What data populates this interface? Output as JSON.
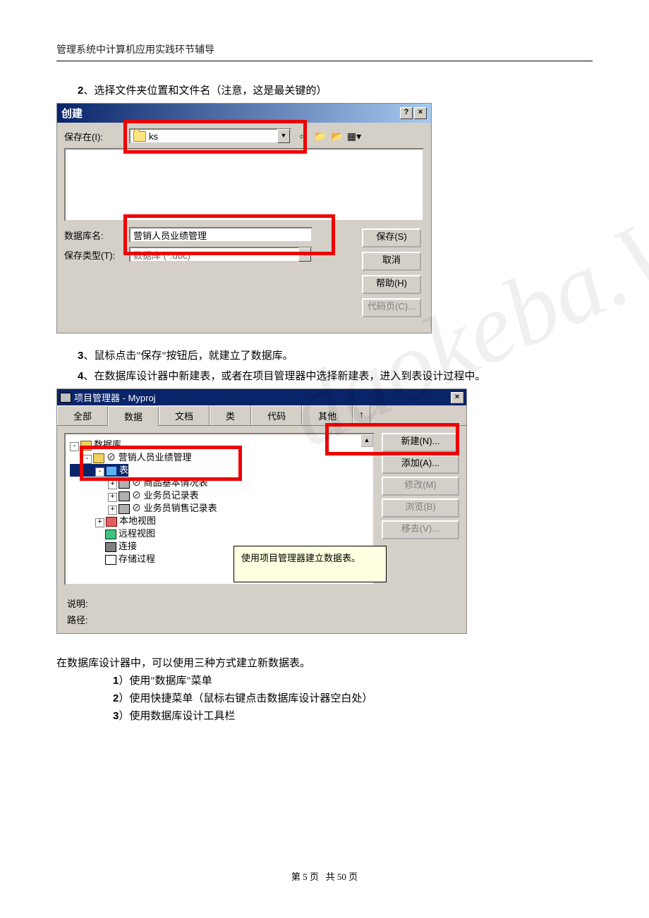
{
  "header": "管理系统中计算机应用实践环节辅导",
  "step2": {
    "num": "2",
    "text": "、选择文件夹位置和文件名（注意，这是最关键的）"
  },
  "createDialog": {
    "title": "创建",
    "saveInLabel": "保存在(I):",
    "saveInValue": "ks",
    "dbNameLabel": "数据库名:",
    "dbNameValue": "营销人员业绩管理",
    "saveTypeLabel": "保存类型(T):",
    "saveTypeValue": "数据库 (*.dbc)",
    "buttons": {
      "save": "保存(S)",
      "cancel": "取消",
      "help": "帮助(H)",
      "codepage": "代码页(C)..."
    }
  },
  "step3": {
    "num": "3",
    "text": "、鼠标点击\"保存\"按钮后，就建立了数据库。"
  },
  "step4": {
    "num": "4",
    "text": "、在数据库设计器中新建表，或者在项目管理器中选择新建表，进入到表设计过程中。"
  },
  "projectManager": {
    "title": "项目管理器 - Myproj",
    "tabs": [
      "全部",
      "数据",
      "文档",
      "类",
      "代码",
      "其他"
    ],
    "tree": {
      "root": "数据库",
      "db": "⊘ 营销人员业绩管理",
      "tables": "表",
      "items": [
        "⊘ 商品基本情况表",
        "⊘ 业务员记录表",
        "⊘ 业务员销售记录表"
      ],
      "localView": "本地视图",
      "remoteView": "远程视图",
      "connection": "连接",
      "storedProc": "存储过程"
    },
    "buttons": {
      "new": "新建(N)...",
      "add": "添加(A)...",
      "modify": "修改(M)",
      "browse": "浏览(B)",
      "remove": "移去(V)..."
    },
    "tooltip": "使用项目管理器建立数据表。",
    "descLabel": "说明:",
    "pathLabel": "路径:"
  },
  "bodyText": "在数据库设计器中，可以使用三种方式建立新数据表。",
  "methods": [
    {
      "num": "1",
      "text": "）使用\"数据库\"菜单"
    },
    {
      "num": "2",
      "text": "）使用快捷菜单（鼠标右键点击数据库设计器空白处）"
    },
    {
      "num": "3",
      "text": "）使用数据库设计工具栏"
    }
  ],
  "footer": {
    "current": "5",
    "total": "50",
    "template": "第 {cur} 页   共 {tot} 页"
  },
  "watermark": "daokeba.Wang"
}
